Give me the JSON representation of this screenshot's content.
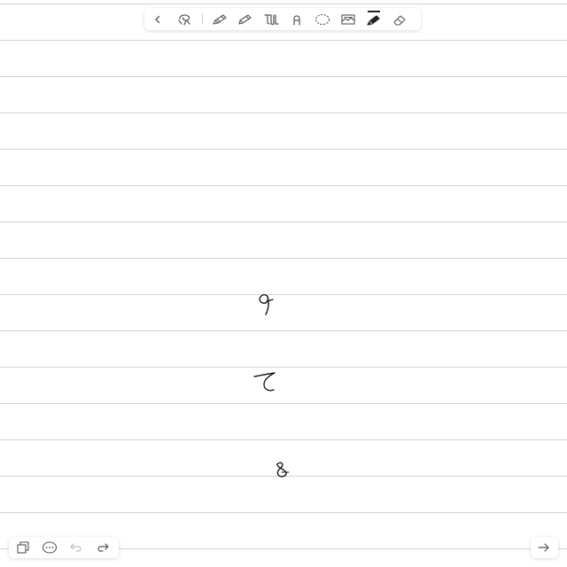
{
  "canvas": {
    "background_color": "#ffffff",
    "rule_color": "#c9d3e1",
    "ink_color": "#1a1a1a",
    "handwritten_marks": [
      "9",
      "て",
      "8"
    ]
  },
  "toolbar": {
    "items": [
      {
        "icon": "chevron-left-icon"
      },
      {
        "icon": "lasso-stamp-icon"
      },
      {
        "icon": "pencil-icon"
      },
      {
        "icon": "pen-icon"
      },
      {
        "icon": "text-handwriting-icon"
      },
      {
        "icon": "shape-icon"
      },
      {
        "icon": "lasso-select-icon"
      },
      {
        "icon": "image-insert-icon"
      },
      {
        "icon": "highlighter-icon",
        "active": true
      },
      {
        "icon": "eraser-icon"
      }
    ]
  },
  "bottom_bar": {
    "left_items": [
      {
        "icon": "pages-icon"
      },
      {
        "icon": "more-options-icon"
      },
      {
        "icon": "undo-icon",
        "disabled": true
      },
      {
        "icon": "redo-icon"
      }
    ],
    "right_item": {
      "icon": "next-page-arrow-icon"
    }
  }
}
